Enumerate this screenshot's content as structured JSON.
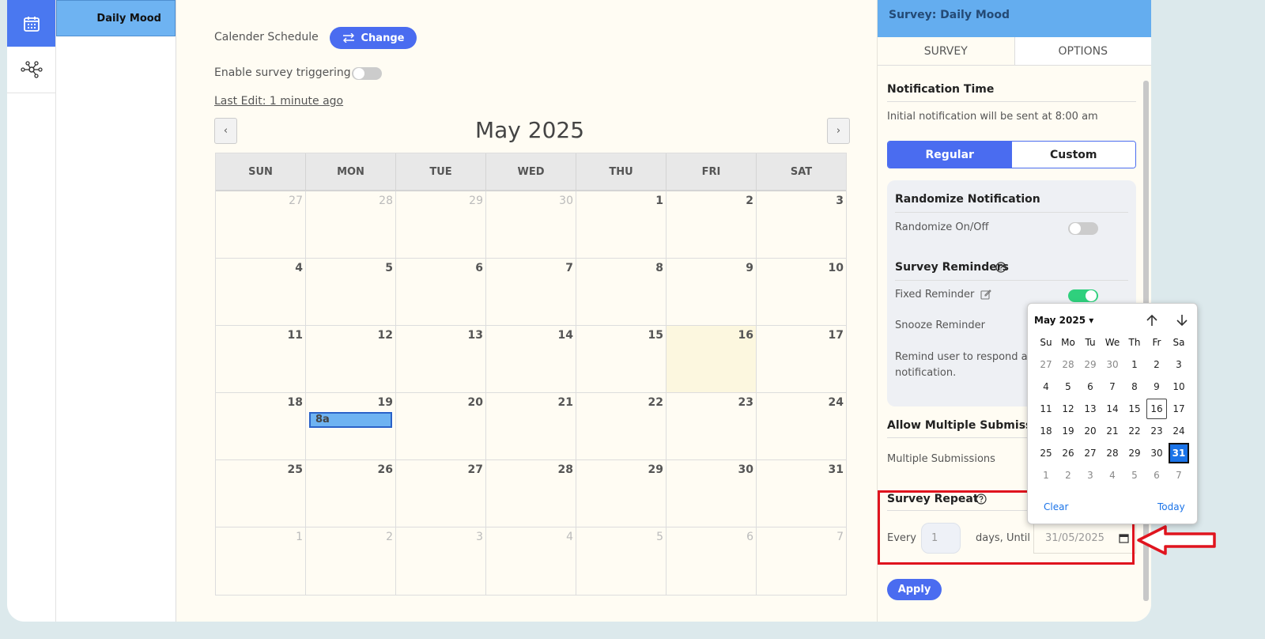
{
  "sidebar": {
    "active_item": "Daily Mood"
  },
  "main": {
    "schedule_label": "Calender Schedule",
    "change_label": "Change",
    "trigger_label": "Enable survey triggering",
    "last_edit": "Last Edit: 1 minute ago",
    "month_title": "May 2025",
    "prev": "‹",
    "next": "›",
    "weekdays": [
      "SUN",
      "MON",
      "TUE",
      "WED",
      "THU",
      "FRI",
      "SAT"
    ],
    "weeks": [
      [
        "27",
        "28",
        "29",
        "30",
        "1",
        "2",
        "3"
      ],
      [
        "4",
        "5",
        "6",
        "7",
        "8",
        "9",
        "10"
      ],
      [
        "11",
        "12",
        "13",
        "14",
        "15",
        "16",
        "17"
      ],
      [
        "18",
        "19",
        "20",
        "21",
        "22",
        "23",
        "24"
      ],
      [
        "25",
        "26",
        "27",
        "28",
        "29",
        "30",
        "31"
      ],
      [
        "1",
        "2",
        "3",
        "4",
        "5",
        "6",
        "7"
      ]
    ],
    "event_label": "8a"
  },
  "panel": {
    "title": "Survey: Daily Mood",
    "tabs": [
      "SURVEY",
      "OPTIONS"
    ],
    "notification_title": "Notification Time",
    "notification_text": "Initial notification will be sent at 8:00 am",
    "mode_regular": "Regular",
    "mode_custom": "Custom",
    "randomize_title": "Randomize Notification",
    "randomize_label": "Randomize On/Off",
    "reminders_title": "Survey Reminders",
    "fixed_reminder": "Fixed Reminder",
    "snooze_reminder": "Snooze Reminder",
    "remind_text_1": "Remind user to respond af",
    "remind_text_2": "notification.",
    "multi_title": "Allow Multiple Submission",
    "multi_label": "Multiple Submissions",
    "repeat_title": "Survey Repeat",
    "every_label": "Every",
    "every_value": "1",
    "until_label": "days, Until",
    "until_value": "31/05/2025",
    "apply_label": "Apply"
  },
  "datepicker": {
    "month": "May 2025",
    "headers": [
      "Su",
      "Mo",
      "Tu",
      "We",
      "Th",
      "Fr",
      "Sa"
    ],
    "days": [
      "27",
      "28",
      "29",
      "30",
      "1",
      "2",
      "3",
      "4",
      "5",
      "6",
      "7",
      "8",
      "9",
      "10",
      "11",
      "12",
      "13",
      "14",
      "15",
      "16",
      "17",
      "18",
      "19",
      "20",
      "21",
      "22",
      "23",
      "24",
      "25",
      "26",
      "27",
      "28",
      "29",
      "30",
      "31",
      "1",
      "2",
      "3",
      "4",
      "5",
      "6",
      "7"
    ],
    "clear": "Clear",
    "today": "Today"
  },
  "colors": {
    "accent": "#4a6cf0",
    "header_blue": "#64adef",
    "highlight_red": "#e0141e",
    "toggle_on": "#2fd07d"
  }
}
